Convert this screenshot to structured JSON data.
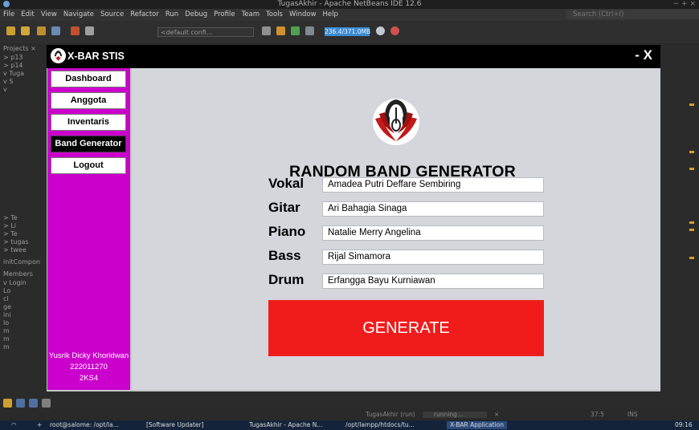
{
  "ide": {
    "title": "TugasAkhir - Apache NetBeans IDE 12.6",
    "window_controls": "− + ×",
    "menu": [
      "File",
      "Edit",
      "View",
      "Navigate",
      "Source",
      "Refactor",
      "Run",
      "Debug",
      "Profile",
      "Team",
      "Tools",
      "Window",
      "Help"
    ],
    "search_placeholder": "Search (Ctrl+I)",
    "config_select": "<default confi...",
    "memory": "236.4/371.0MB",
    "left_rows": [
      {
        "text": "Projects ×"
      },
      {
        "text": "> p13"
      },
      {
        "text": "> p14"
      },
      {
        "text": "v Tuga"
      },
      {
        "text": "v S"
      },
      {
        "text": "v"
      },
      {
        "text": "> Te"
      },
      {
        "text": "> Li"
      },
      {
        "text": "> Te"
      },
      {
        "text": "> tugas"
      },
      {
        "text": "> twee"
      },
      {
        "text": "initCompon"
      },
      {
        "text": "Members"
      },
      {
        "text": "v Login"
      },
      {
        "text": "Lo"
      },
      {
        "text": "cl"
      },
      {
        "text": "ge"
      },
      {
        "text": "ini"
      },
      {
        "text": "lo"
      },
      {
        "text": "m"
      },
      {
        "text": "m"
      },
      {
        "text": "m"
      }
    ],
    "status": {
      "run": "TugasAkhir (run)",
      "running": "running...",
      "position": "37:5",
      "mode": "INS"
    },
    "taskbar": {
      "items": [
        "root@salome: /opt/la...",
        "[Software Updater]",
        "TugasAkhir - Apache N...",
        "/opt/lampp/htdocs/tu...",
        "X-BAR Application"
      ],
      "clock": "09:16"
    }
  },
  "app": {
    "title": "X-BAR STIS",
    "close_label": "- X",
    "nav": [
      {
        "label": "Dashboard",
        "active": false
      },
      {
        "label": "Anggota",
        "active": false
      },
      {
        "label": "Inventaris",
        "active": false
      },
      {
        "label": "Band Generator",
        "active": true
      },
      {
        "label": "Logout",
        "active": false
      }
    ],
    "user": {
      "name": "Yusrik Dicky Khoridwan",
      "nim": "222011270",
      "class": "2KS4"
    },
    "heading": "RANDOM BAND GENERATOR",
    "fields": [
      {
        "label": "Vokal",
        "value": "Amadea Putri Deffare Sembiring"
      },
      {
        "label": "Gitar",
        "value": "Ari Bahagia Sinaga"
      },
      {
        "label": "Piano",
        "value": "Natalie Merry Angelina"
      },
      {
        "label": "Bass",
        "value": "Rijal Simamora"
      },
      {
        "label": "Drum",
        "value": "Erfangga Bayu Kurniawan"
      }
    ],
    "generate_label": "GENERATE",
    "colors": {
      "sidebar": "#cc00cc",
      "generate": "#f01c1c",
      "content_bg": "#d4d6dc"
    }
  }
}
